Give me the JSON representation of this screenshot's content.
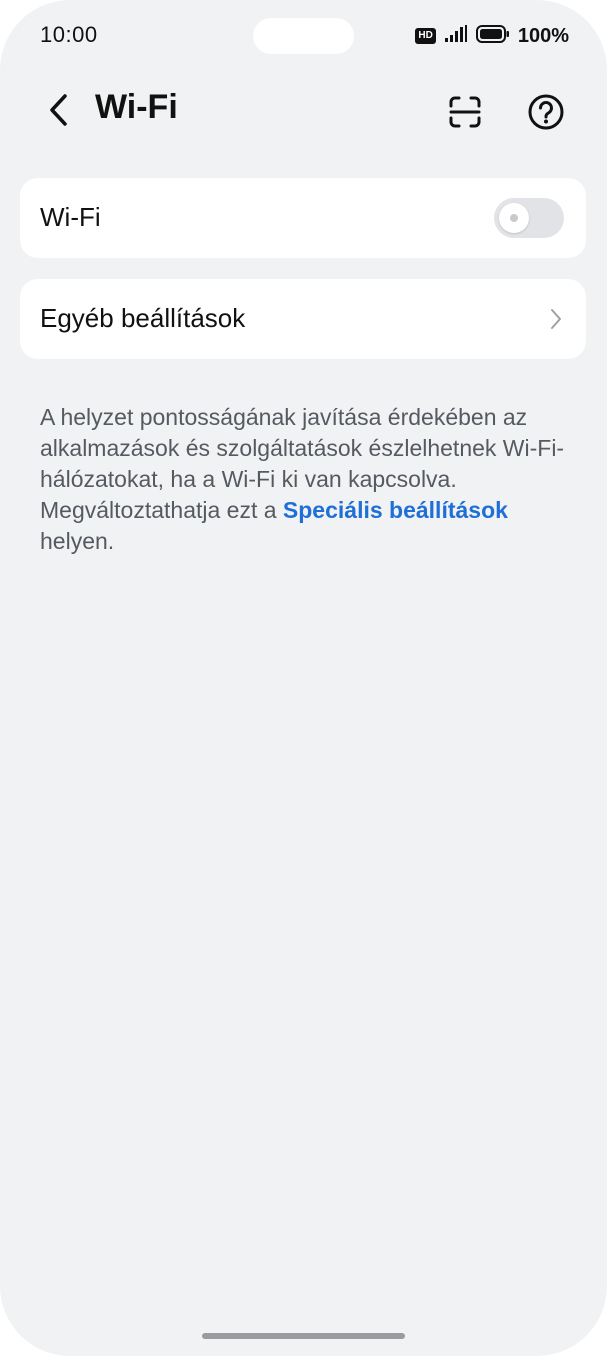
{
  "status_bar": {
    "time": "10:00",
    "hd_badge": "HD",
    "battery_percent": "100%"
  },
  "header": {
    "title": "Wi-Fi"
  },
  "wifi_card": {
    "label": "Wi-Fi",
    "toggle_on": false
  },
  "other_settings_card": {
    "label": "Egyéb beállítások"
  },
  "description": {
    "text_before_link": "A helyzet pontosságának javítása érdekében az alkalmazások és szolgáltatások észlelhetnek Wi-Fi-hálózatokat, ha a Wi-Fi ki van kapcsolva. Megváltoztathatja ezt a ",
    "link_text": "Speciális beállítások",
    "text_after_link": " helyen."
  },
  "icons": {
    "back": "back-arrow-icon",
    "scan": "scan-icon",
    "help": "help-icon",
    "chevron": "chevron-right-icon",
    "signal": "signal-icon",
    "battery": "battery-icon"
  },
  "colors": {
    "background": "#f1f2f4",
    "card": "#ffffff",
    "link": "#1f6fd6",
    "toggle_off": "#e2e3e6"
  }
}
